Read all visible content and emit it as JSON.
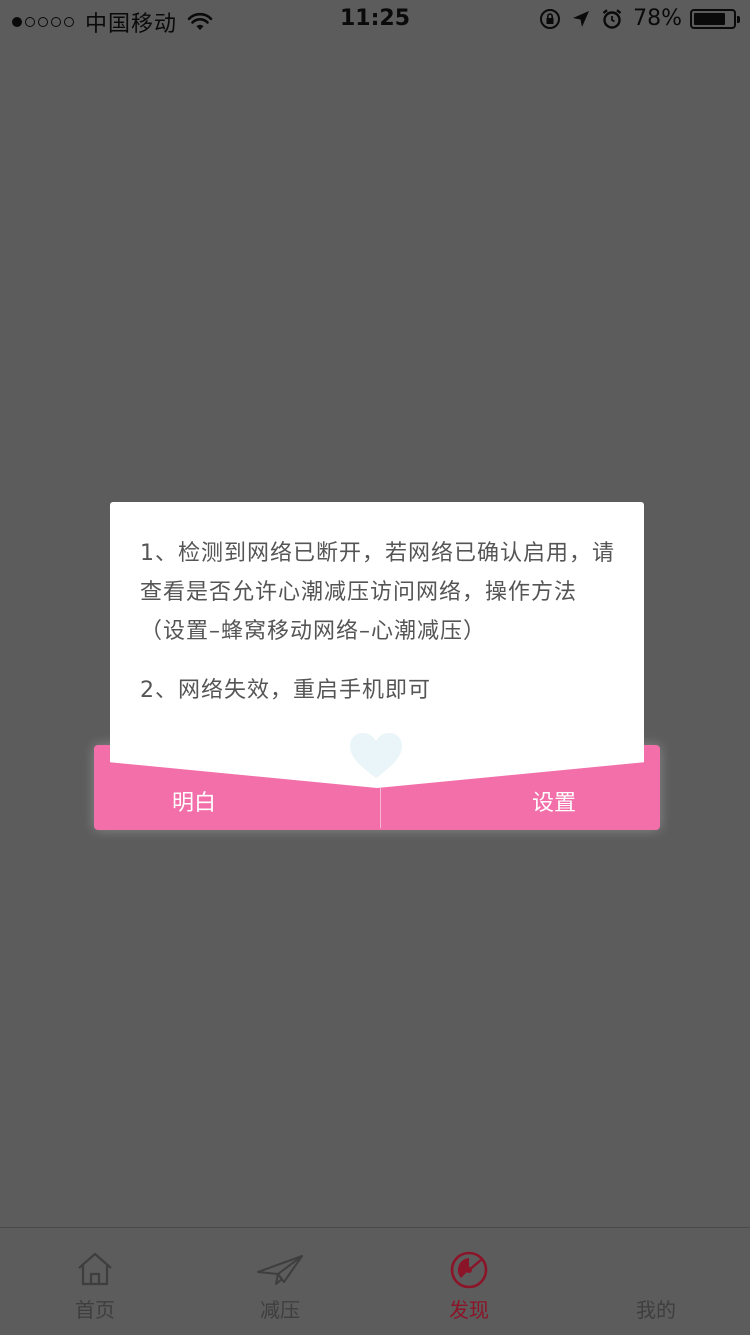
{
  "status_bar": {
    "carrier": "中国移动",
    "time": "11:25",
    "battery_percent": "78%",
    "battery_level": 0.78
  },
  "dialog": {
    "paragraph_1": "1、检测到网络已断开，若网络已确认启用，请查看是否允许心潮减压访问网络，操作方法（设置–蜂窝移动网络–心潮减压）",
    "paragraph_2": "2、网络失效，重启手机即可",
    "ok_label": "明白",
    "settings_label": "设置",
    "accent_color": "#f26fa9"
  },
  "tab_bar": {
    "tabs": [
      {
        "label": "首页",
        "icon": "home-icon"
      },
      {
        "label": "减压",
        "icon": "paper-plane-icon"
      },
      {
        "label": "发现",
        "icon": "discover-icon",
        "active": true
      },
      {
        "label": "我的",
        "icon": "profile-icon"
      }
    ],
    "active_color": "#8c1428"
  }
}
